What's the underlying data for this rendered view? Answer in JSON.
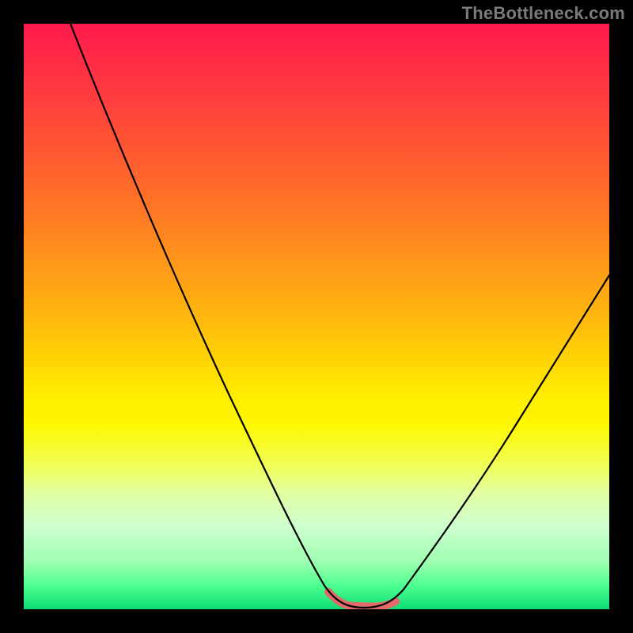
{
  "watermark": "TheBottleneck.com",
  "chart_data": {
    "type": "line",
    "title": "",
    "xlabel": "",
    "ylabel": "",
    "xlim": [
      0,
      100
    ],
    "ylim": [
      0,
      100
    ],
    "grid": false,
    "legend": false,
    "background": "vertical-gradient red→green",
    "series": [
      {
        "name": "bottleneck-curve",
        "color": "#000000",
        "x": [
          8,
          12,
          16,
          20,
          24,
          28,
          32,
          36,
          40,
          44,
          48,
          50,
          52,
          54,
          56,
          58,
          60,
          62,
          64,
          68,
          72,
          76,
          80,
          84,
          88,
          92,
          96,
          100
        ],
        "y": [
          100,
          92,
          84,
          76,
          68,
          60,
          52,
          44,
          36,
          28,
          18,
          12,
          7,
          3,
          1,
          0,
          0,
          0,
          1,
          4,
          9,
          15,
          22,
          29,
          36,
          43,
          50,
          57
        ]
      },
      {
        "name": "sweet-spot-highlight",
        "color": "#e46a6a",
        "x": [
          52,
          54,
          56,
          58,
          60,
          62,
          64
        ],
        "y": [
          3,
          1.2,
          0.5,
          0.3,
          0.3,
          0.5,
          1.4
        ]
      }
    ],
    "annotations": []
  }
}
